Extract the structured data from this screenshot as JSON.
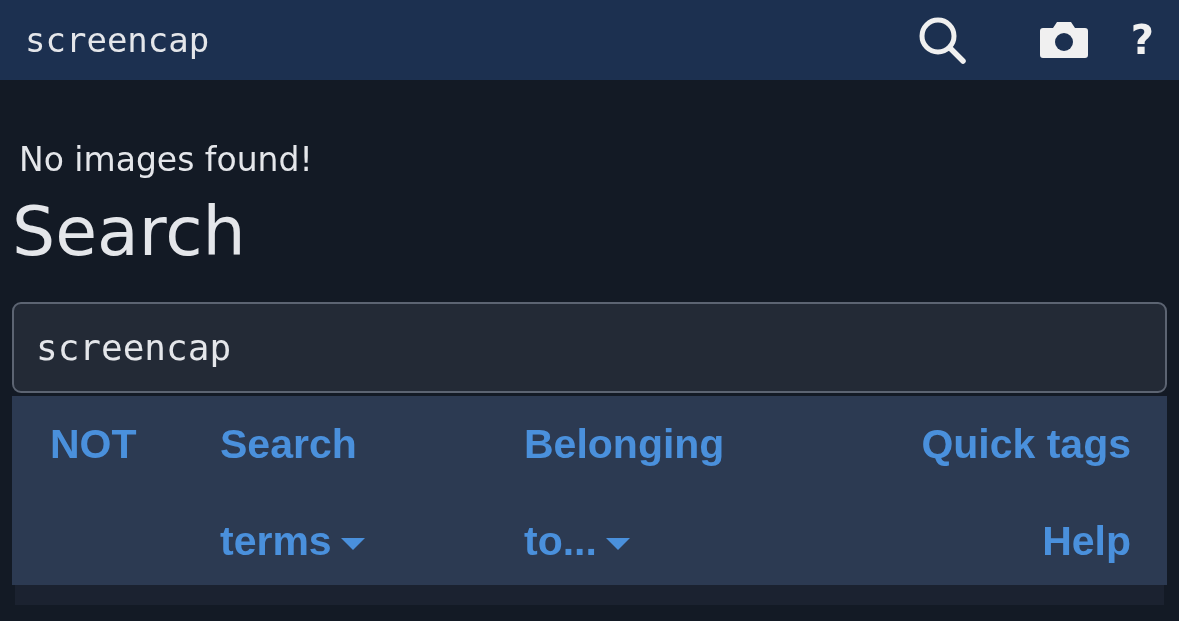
{
  "header": {
    "title": "screencap",
    "help": "?"
  },
  "message": "No images found!",
  "heading": "Search",
  "search": {
    "value": "screencap"
  },
  "options": [
    {
      "label": "NOT",
      "kind": "toggle"
    },
    {
      "label": "Search terms",
      "kind": "dropdown"
    },
    {
      "label": "Belonging to...",
      "kind": "dropdown"
    },
    {
      "label": "Quick tags Help",
      "kind": "link"
    }
  ]
}
